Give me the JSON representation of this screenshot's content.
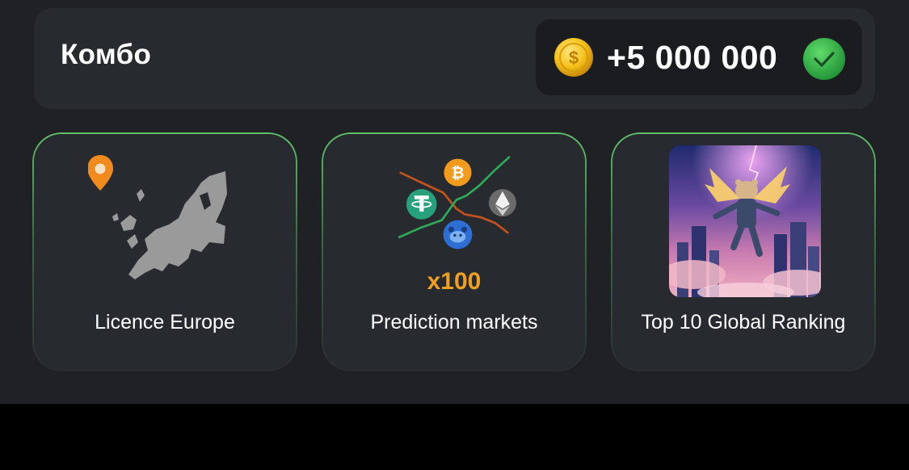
{
  "combo": {
    "title": "Комбо",
    "reward": "+5 000 000",
    "coin_icon": "coin-icon",
    "status_icon": "check-icon",
    "status_color": "#2fb34a"
  },
  "cards": [
    {
      "label": "Licence Europe",
      "icon": "europe-map-icon"
    },
    {
      "label": "Prediction markets",
      "icon": "crypto-chart-icon",
      "badge": "x100"
    },
    {
      "label": "Top 10 Global Ranking",
      "icon": "flying-hamster-image"
    }
  ],
  "colors": {
    "background": "#1f2125",
    "card": "#272a2f",
    "card_border": "#5fbf6a",
    "accent_orange": "#f0a020"
  }
}
